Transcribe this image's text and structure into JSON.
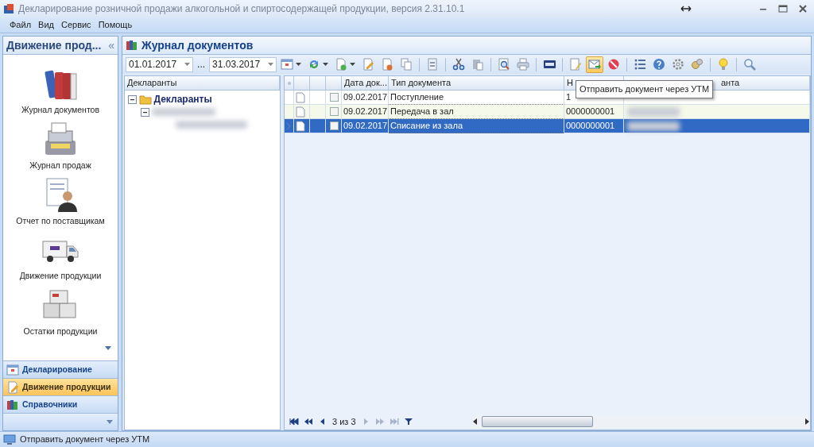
{
  "window": {
    "title": "Декларирование розничной продажи алкогольной и спиртосодержащей продукции, версия 2.31.10.1"
  },
  "menu": [
    "Файл",
    "Вид",
    "Сервис",
    "Помощь"
  ],
  "sidebar": {
    "title": "Движение прод...",
    "collapse": "«",
    "items": [
      {
        "label": "Журнал документов",
        "kind": "books"
      },
      {
        "label": "Журнал продаж",
        "kind": "register"
      },
      {
        "label": "Отчет по поставщикам",
        "kind": "person"
      },
      {
        "label": "Движение продукции",
        "kind": "truck"
      },
      {
        "label": "Остатки продукции",
        "kind": "boxes"
      }
    ],
    "sections": [
      {
        "label": "Декларирование",
        "kind": "calendar",
        "selected": false
      },
      {
        "label": "Движение продукции",
        "kind": "edit",
        "selected": true
      },
      {
        "label": "Справочники",
        "kind": "books",
        "selected": false
      }
    ]
  },
  "panel": {
    "title": "Журнал документов"
  },
  "toolbar": {
    "date_from": "01.01.2017",
    "range_sep": "...",
    "date_to": "31.03.2017",
    "buttons": [
      {
        "kind": "calendar",
        "dropdown": true,
        "highlighted": false
      },
      {
        "kind": "refresh",
        "dropdown": true,
        "highlighted": false
      },
      {
        "kind": "new",
        "dropdown": true,
        "highlighted": false
      },
      {
        "kind": "edit",
        "dropdown": false,
        "highlighted": false
      },
      {
        "kind": "delete",
        "dropdown": false,
        "highlighted": false
      },
      {
        "kind": "copy",
        "dropdown": false,
        "highlighted": false
      },
      {
        "kind": "sep"
      },
      {
        "kind": "doc",
        "dropdown": false,
        "highlighted": false
      },
      {
        "kind": "sep"
      },
      {
        "kind": "cut",
        "dropdown": false,
        "highlighted": false
      },
      {
        "kind": "paste",
        "dropdown": false,
        "highlighted": false
      },
      {
        "kind": "sep"
      },
      {
        "kind": "preview",
        "dropdown": false,
        "highlighted": false
      },
      {
        "kind": "print",
        "dropdown": false,
        "highlighted": false
      },
      {
        "kind": "sep"
      },
      {
        "kind": "xml",
        "dropdown": false,
        "highlighted": false
      },
      {
        "kind": "sep"
      },
      {
        "kind": "sign",
        "dropdown": false,
        "highlighted": false
      },
      {
        "kind": "send",
        "dropdown": false,
        "highlighted": true
      },
      {
        "kind": "cancel",
        "dropdown": false,
        "highlighted": false
      },
      {
        "kind": "sep"
      },
      {
        "kind": "list",
        "dropdown": false,
        "highlighted": false
      },
      {
        "kind": "help",
        "dropdown": false,
        "highlighted": false
      },
      {
        "kind": "gear",
        "dropdown": false,
        "highlighted": false
      },
      {
        "kind": "gears",
        "dropdown": false,
        "highlighted": false
      },
      {
        "kind": "sep"
      },
      {
        "kind": "bulb",
        "dropdown": false,
        "highlighted": false
      },
      {
        "kind": "sep"
      },
      {
        "kind": "search",
        "dropdown": false,
        "highlighted": false
      }
    ]
  },
  "tree": {
    "header": "Декларанты",
    "items": [
      {
        "label": "Декларанты",
        "expanded": true,
        "children": [
          {
            "expanded": true
          }
        ]
      }
    ]
  },
  "table": {
    "columns": [
      "Дата док...",
      "Тип документа",
      "Н",
      "анта"
    ],
    "rows": [
      {
        "selected": false,
        "checked": false,
        "date": "09.02.2017",
        "type": "Поступление",
        "number": "1"
      },
      {
        "selected": false,
        "checked": false,
        "date": "09.02.2017",
        "type": "Передача в зал",
        "number": "0000000001"
      },
      {
        "selected": true,
        "checked": false,
        "date": "09.02.2017",
        "type": "Списание из зала",
        "number": "0000000001"
      }
    ]
  },
  "pager": {
    "position": "3 из 3"
  },
  "tooltip": "Отправить документ через УТМ",
  "status_bar": "Отправить документ через УТМ"
}
